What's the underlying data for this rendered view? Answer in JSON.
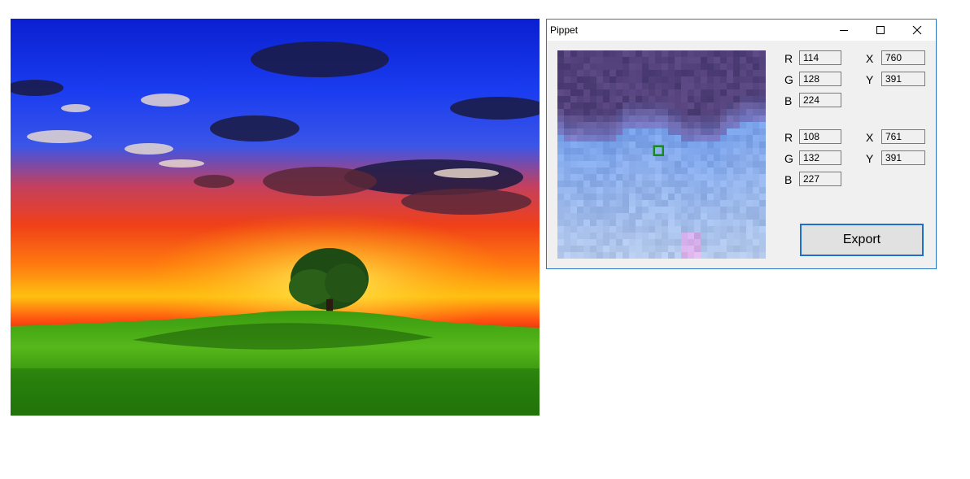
{
  "window": {
    "title": "Pippet",
    "controls": {
      "minimize_icon": "minimize-icon",
      "maximize_icon": "maximize-icon",
      "close_icon": "close-icon"
    }
  },
  "colors": {
    "window_border": "#2b79c2",
    "marker": "#1a8a1a",
    "export_border": "#1e6fd0"
  },
  "sample1": {
    "r_label": "R",
    "g_label": "G",
    "b_label": "B",
    "r": "114",
    "g": "128",
    "b": "224",
    "x_label": "X",
    "y_label": "Y",
    "x": "760",
    "y": "391"
  },
  "sample2": {
    "r_label": "R",
    "g_label": "G",
    "b_label": "B",
    "r": "108",
    "g": "132",
    "b": "227",
    "x_label": "X",
    "y_label": "Y",
    "x": "761",
    "y": "391"
  },
  "export_label": "Export"
}
